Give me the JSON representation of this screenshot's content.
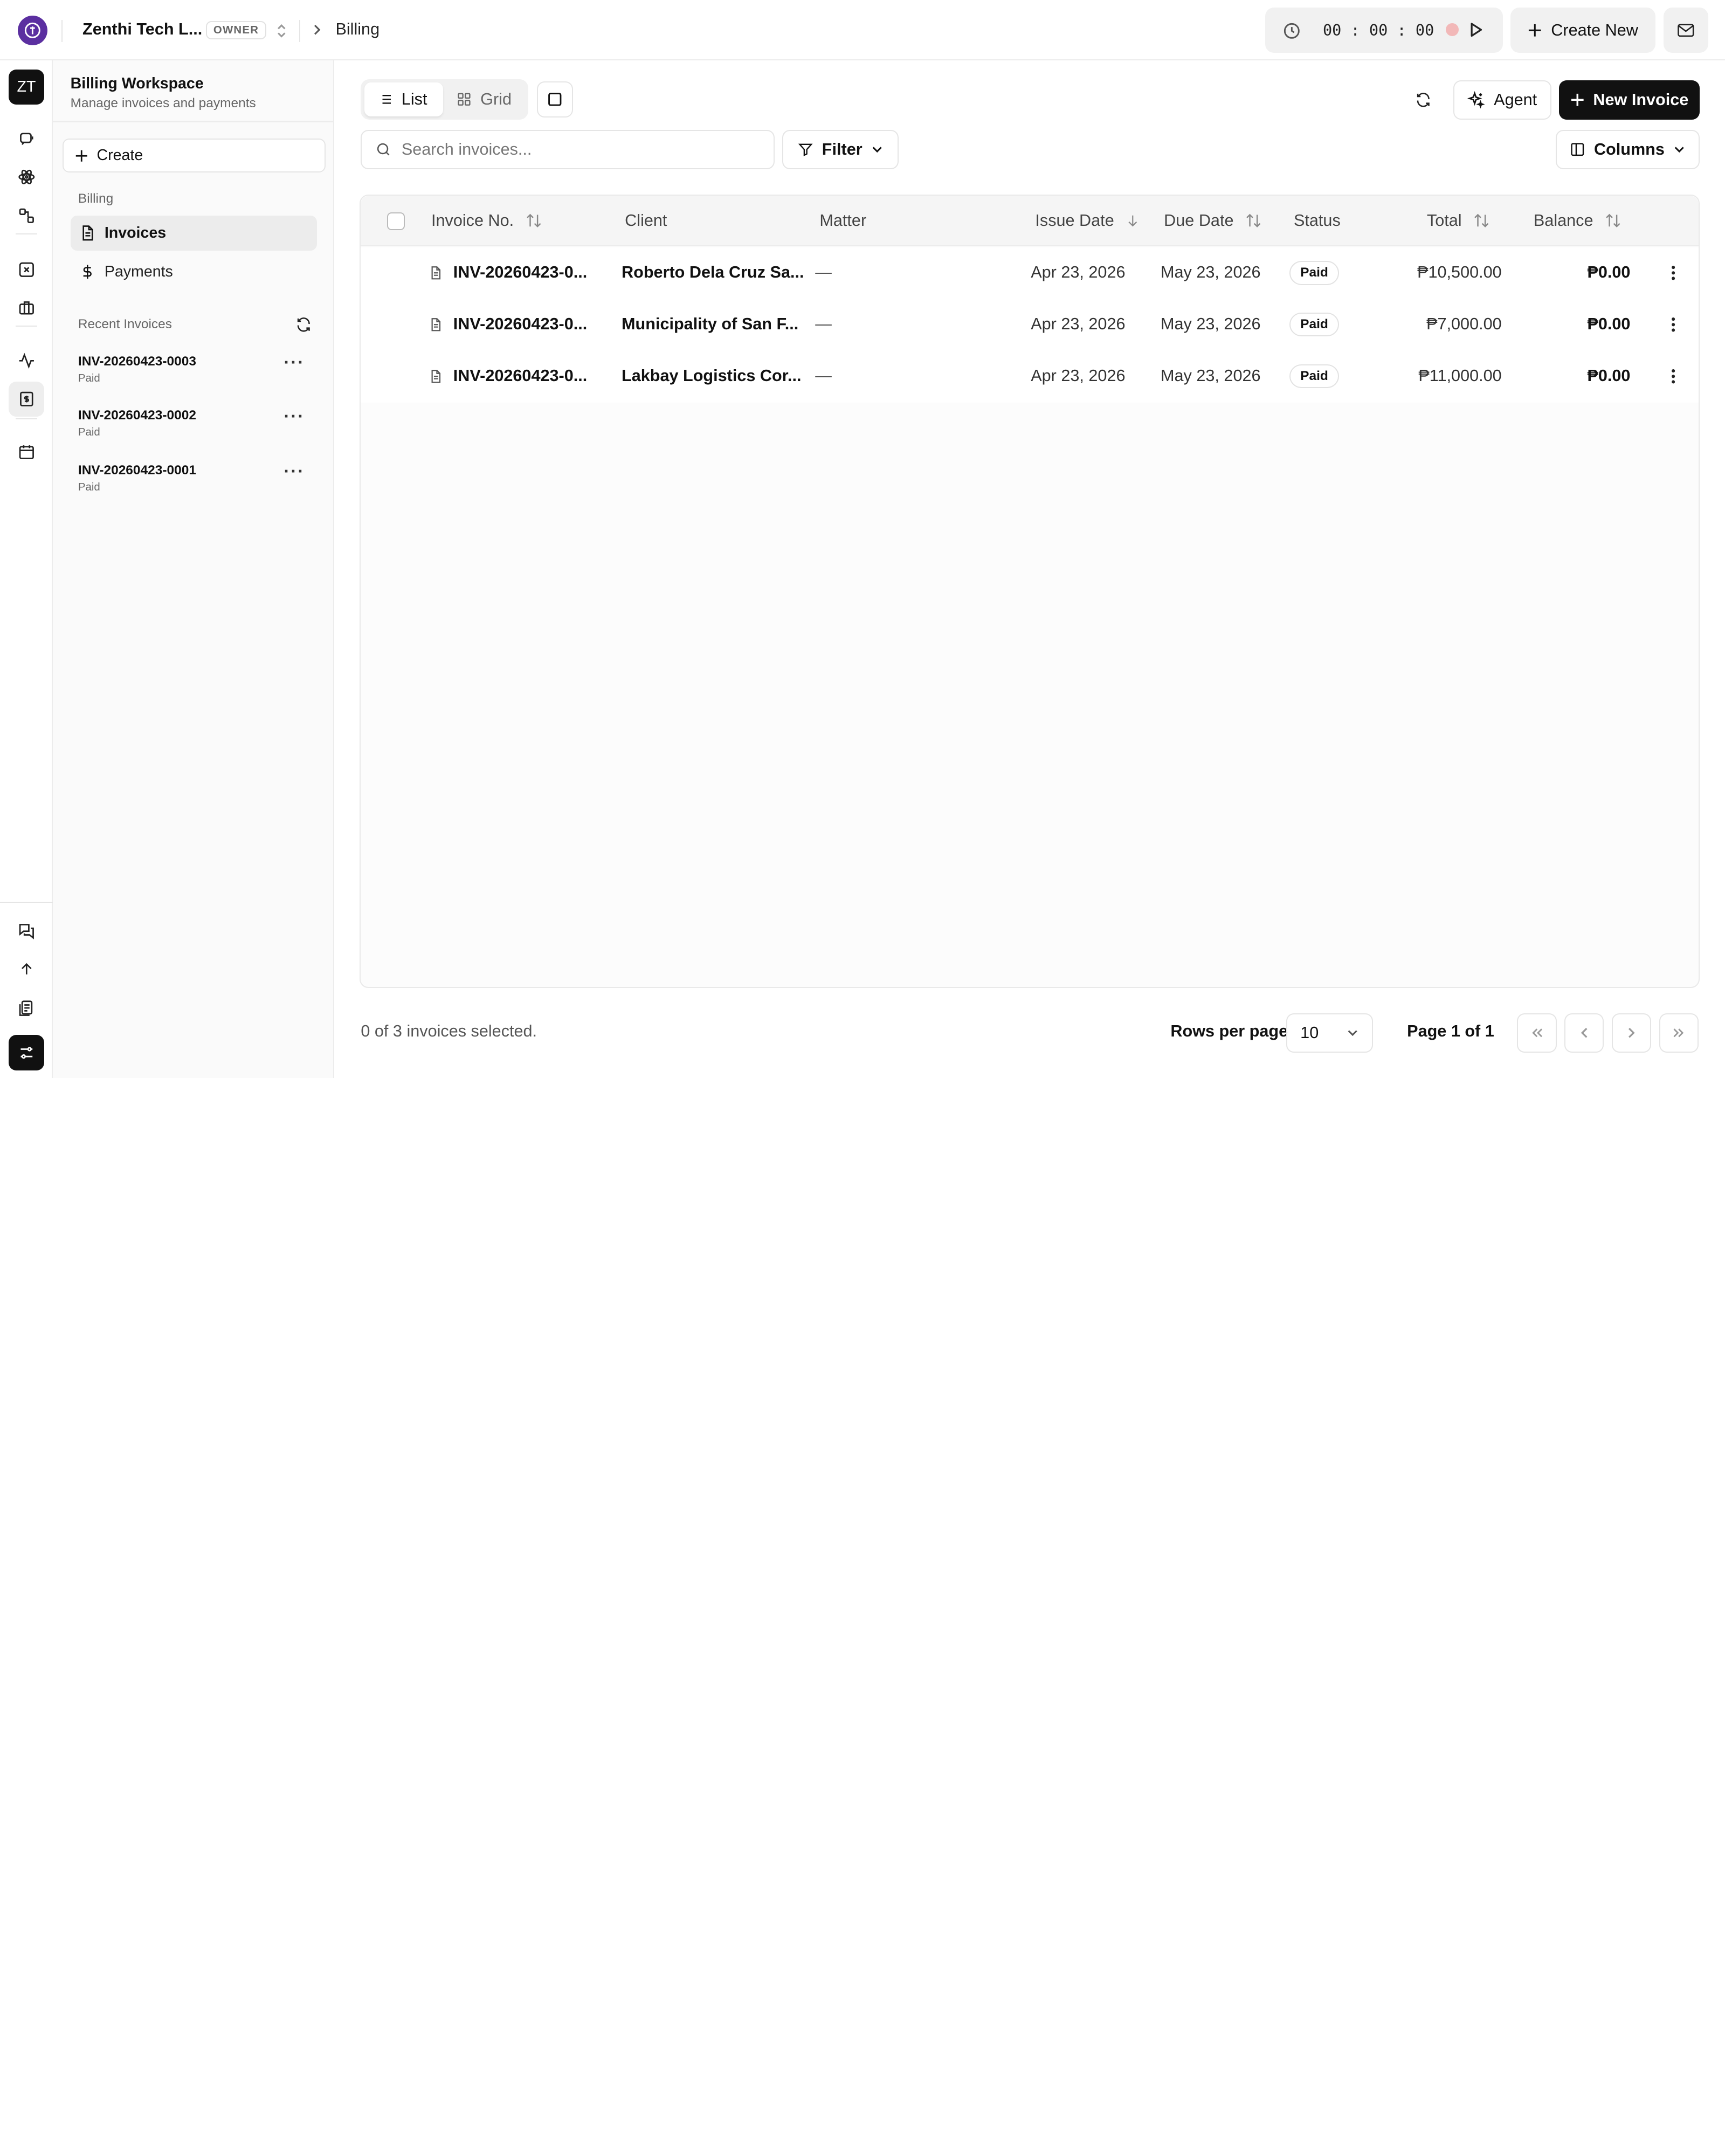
{
  "topbar": {
    "org_name": "Zenthi Tech L...",
    "org_role": "OWNER",
    "breadcrumb": "Billing",
    "timer": {
      "hours": "00",
      "minutes": "00",
      "seconds": "00",
      "display": "00 : 00 : 00"
    },
    "create_new_label": "Create New"
  },
  "rail": {
    "avatar_initials": "ZT",
    "items": [
      "chat-bot-icon",
      "atom-icon",
      "workflow-icon",
      "x-square-icon",
      "briefcase-icon",
      "activity-icon",
      "billing-icon",
      "calendar-icon"
    ],
    "bottom_items": [
      "messages-icon",
      "arrow-up-icon",
      "document-stack-icon",
      "settings-sliders-icon"
    ]
  },
  "panel": {
    "workspace_title": "Billing Workspace",
    "workspace_subtitle": "Manage invoices and payments",
    "create_label": "Create",
    "group_label": "Billing",
    "nav": [
      {
        "label": "Invoices",
        "icon": "document-icon",
        "active": true
      },
      {
        "label": "Payments",
        "icon": "dollar-icon",
        "active": false
      }
    ],
    "recent_label": "Recent Invoices",
    "recent": [
      {
        "number": "INV-20260423-0003",
        "status": "Paid"
      },
      {
        "number": "INV-20260423-0002",
        "status": "Paid"
      },
      {
        "number": "INV-20260423-0001",
        "status": "Paid"
      }
    ]
  },
  "toolbar": {
    "list_label": "List",
    "grid_label": "Grid",
    "agent_label": "Agent",
    "new_invoice_label": "New Invoice",
    "search_placeholder": "Search invoices...",
    "filter_label": "Filter",
    "columns_label": "Columns"
  },
  "table": {
    "headers": {
      "invoice_no": "Invoice No.",
      "client": "Client",
      "matter": "Matter",
      "issue_date": "Issue Date",
      "due_date": "Due Date",
      "status": "Status",
      "total": "Total",
      "balance": "Balance"
    },
    "rows": [
      {
        "invoice_no": "INV-20260423-0...",
        "client": "Roberto Dela Cruz Sa...",
        "matter": "—",
        "issue_date": "Apr 23, 2026",
        "due_date": "May 23, 2026",
        "status": "Paid",
        "total": "₱10,500.00",
        "balance": "₱0.00"
      },
      {
        "invoice_no": "INV-20260423-0...",
        "client": "Municipality of San F...",
        "matter": "—",
        "issue_date": "Apr 23, 2026",
        "due_date": "May 23, 2026",
        "status": "Paid",
        "total": "₱7,000.00",
        "balance": "₱0.00"
      },
      {
        "invoice_no": "INV-20260423-0...",
        "client": "Lakbay Logistics Cor...",
        "matter": "—",
        "issue_date": "Apr 23, 2026",
        "due_date": "May 23, 2026",
        "status": "Paid",
        "total": "₱11,000.00",
        "balance": "₱0.00"
      }
    ]
  },
  "footer": {
    "selection": "0 of 3 invoices selected.",
    "rows_per_page_label": "Rows per page",
    "rows_per_page_value": "10",
    "page_label": "Page 1 of 1"
  },
  "colors": {
    "brand": "#5b2fa0",
    "primary_button": "#111111",
    "record_dot": "#f2b8b8"
  }
}
